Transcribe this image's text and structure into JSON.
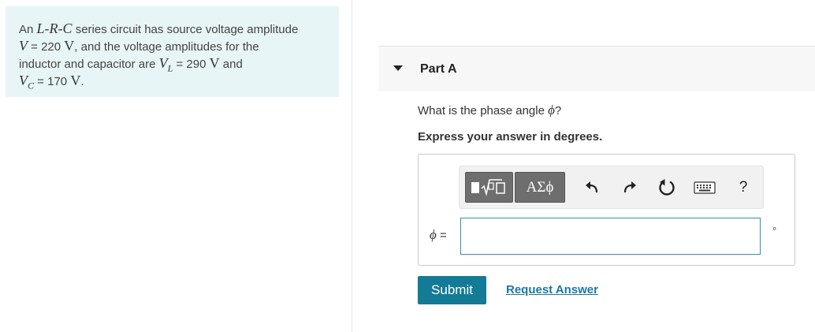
{
  "problem": {
    "t1": "An",
    "m_lrc": "L-R-C",
    "t2": " series circuit has source voltage amplitude",
    "m_v": "V",
    "t3": " = 220 ",
    "u_v1": "V",
    "t4": ", and the voltage amplitudes for the",
    "t5": "inductor and capacitor are ",
    "m_vl": "V",
    "m_vl_sub": "L",
    "t6": " = 290 ",
    "u_v2": "V",
    "t7": " and",
    "m_vc": "V",
    "m_vc_sub": "C",
    "t8": " = 170 ",
    "u_v3": "V",
    "t9": "."
  },
  "part": {
    "title": "Part A"
  },
  "question": {
    "text": "What is the phase angle ",
    "symbol": "ϕ",
    "end": "?"
  },
  "instruction": "Express your answer in degrees.",
  "toolbar": {
    "greek_label": "ΑΣϕ",
    "help_label": "?",
    "icons": [
      "templates-icon",
      "undo-icon",
      "redo-icon",
      "reset-icon",
      "keyboard-icon",
      "help-icon"
    ]
  },
  "answer": {
    "symbol": "ϕ",
    "equals": " =",
    "value": "",
    "unit": "°"
  },
  "buttons": {
    "submit": "Submit",
    "request_answer": "Request Answer"
  },
  "colors": {
    "accent": "#137b95",
    "link": "#1b78a3",
    "problem_bg": "#e8f5f6",
    "input_border": "#3b8ea5"
  }
}
